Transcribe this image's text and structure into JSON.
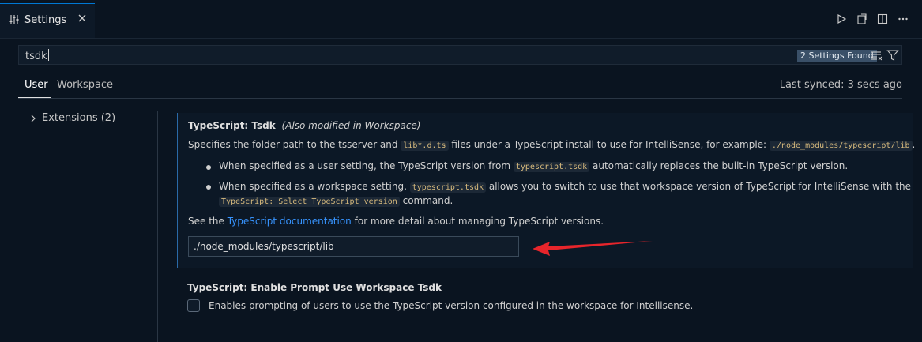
{
  "tab": {
    "label": "Settings",
    "icon": "settings-sliders-icon",
    "close_icon": "close-icon"
  },
  "actions": [
    "run-icon",
    "open-settings-json-icon",
    "split-editor-icon",
    "more-actions-icon"
  ],
  "search": {
    "value": "tsdk",
    "found_badge": "2 Settings Found",
    "clear_filter_icon": "clear-filter-icon",
    "filter_icon": "filter-icon"
  },
  "scope_tabs": {
    "user": "User",
    "workspace": "Workspace",
    "sync_status": "Last synced: 3 secs ago"
  },
  "tree": {
    "extensions_label": "Extensions (2)"
  },
  "setting_tsdk": {
    "title": "TypeScript: Tsdk",
    "modified_prefix": "(Also modified in",
    "modified_link": "Workspace",
    "modified_suffix": ")",
    "desc_part1": "Specifies the folder path to the tsserver and",
    "desc_code1": "lib*.d.ts",
    "desc_part2": "files under a TypeScript install to use for IntelliSense, for example:",
    "desc_code2": "./node_modules/typescript/lib",
    "desc_part3": ".",
    "bullet1_part1": "When specified as a user setting, the TypeScript version from",
    "bullet1_code": "typescript.tsdk",
    "bullet1_part2": "automatically replaces the built-in TypeScript version.",
    "bullet2_part1": "When specified as a workspace setting,",
    "bullet2_code": "typescript.tsdk",
    "bullet2_part2": "allows you to switch to use that workspace version of TypeScript for IntelliSense with the",
    "bullet2_code2": "TypeScript: Select TypeScript version",
    "bullet2_part3": "command.",
    "see_part1": "See the",
    "see_link": "TypeScript documentation",
    "see_part2": "for more detail about managing TypeScript versions.",
    "input_value": "./node_modules/typescript/lib"
  },
  "setting_prompt": {
    "title": "TypeScript: Enable Prompt Use Workspace Tsdk",
    "checked": false,
    "description": "Enables prompting of users to use the TypeScript version configured in the workspace for Intellisense."
  },
  "colors": {
    "accent": "#0078d4",
    "link": "#3794ff",
    "annotation_arrow": "#e8252b"
  }
}
